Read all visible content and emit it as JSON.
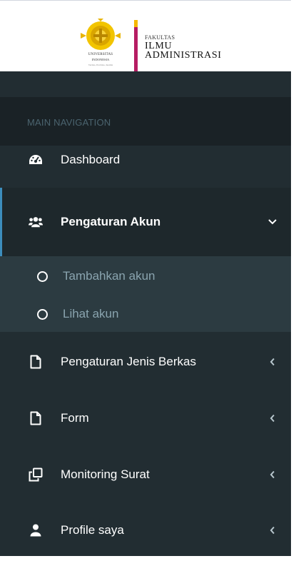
{
  "brand": {
    "seal_line1": "UNIVERSITAS",
    "seal_line2": "INDONESIA",
    "seal_line3": "Veritas, Probitas, Iustitia",
    "kicker": "FAKULTAS",
    "line1": "ILMU",
    "line2": "ADMINISTRASI",
    "colors": {
      "bar": "#b61d63",
      "bar_top": "#f5b800"
    }
  },
  "sidebar": {
    "header": "MAIN NAVIGATION",
    "items": [
      {
        "label": "Dashboard",
        "icon": "dashboard-icon"
      },
      {
        "label": "Pengaturan Akun",
        "icon": "users-icon",
        "expanded": true,
        "children": [
          {
            "label": "Tambahkan akun",
            "icon": "circle-o-icon"
          },
          {
            "label": "Lihat akun",
            "icon": "circle-o-icon"
          }
        ]
      },
      {
        "label": "Pengaturan Jenis Berkas",
        "icon": "file-icon"
      },
      {
        "label": "Form",
        "icon": "file-icon"
      },
      {
        "label": "Monitoring Surat",
        "icon": "clone-icon"
      },
      {
        "label": "Profile saya",
        "icon": "user-icon"
      }
    ],
    "colors": {
      "bg": "#222d32",
      "header_bg": "#1a2226",
      "active_bg": "#1e282c",
      "submenu_bg": "#2c3b41",
      "accent": "#3c8dbc"
    }
  }
}
